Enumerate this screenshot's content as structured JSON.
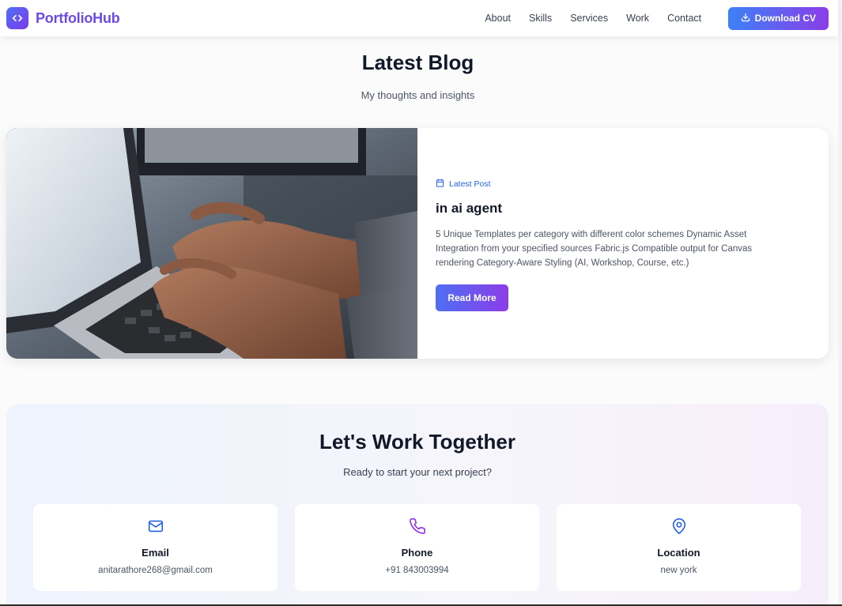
{
  "nav": {
    "brand": "PortfolioHub",
    "links": [
      "About",
      "Skills",
      "Services",
      "Work",
      "Contact"
    ],
    "cta_label": "Download CV"
  },
  "blog": {
    "title": "Latest Blog",
    "subtitle": "My thoughts and insights",
    "card": {
      "badge": "Latest Post",
      "post_title": "in ai agent",
      "excerpt": "5 Unique Templates per category with different color schemes Dynamic Asset Integration from your specified sources Fabric.js Compatible output for Canvas rendering Category-Aware Styling (AI, Workshop, Course, etc.)",
      "read_more": "Read More"
    }
  },
  "contact": {
    "title": "Let's Work Together",
    "subtitle": "Ready to start your next project?",
    "cards": [
      {
        "icon": "mail-icon",
        "label": "Email",
        "value": "anitarathore268@gmail.com",
        "color": "#2563eb"
      },
      {
        "icon": "phone-icon",
        "label": "Phone",
        "value": "+91 843003994",
        "color": "#9333ea"
      },
      {
        "icon": "map-pin-icon",
        "label": "Location",
        "value": "new york",
        "color": "#2563eb"
      }
    ]
  },
  "colors": {
    "brand": "#6d4ae8",
    "accent_blue": "#3b82f6",
    "accent_purple": "#8b3de8"
  }
}
